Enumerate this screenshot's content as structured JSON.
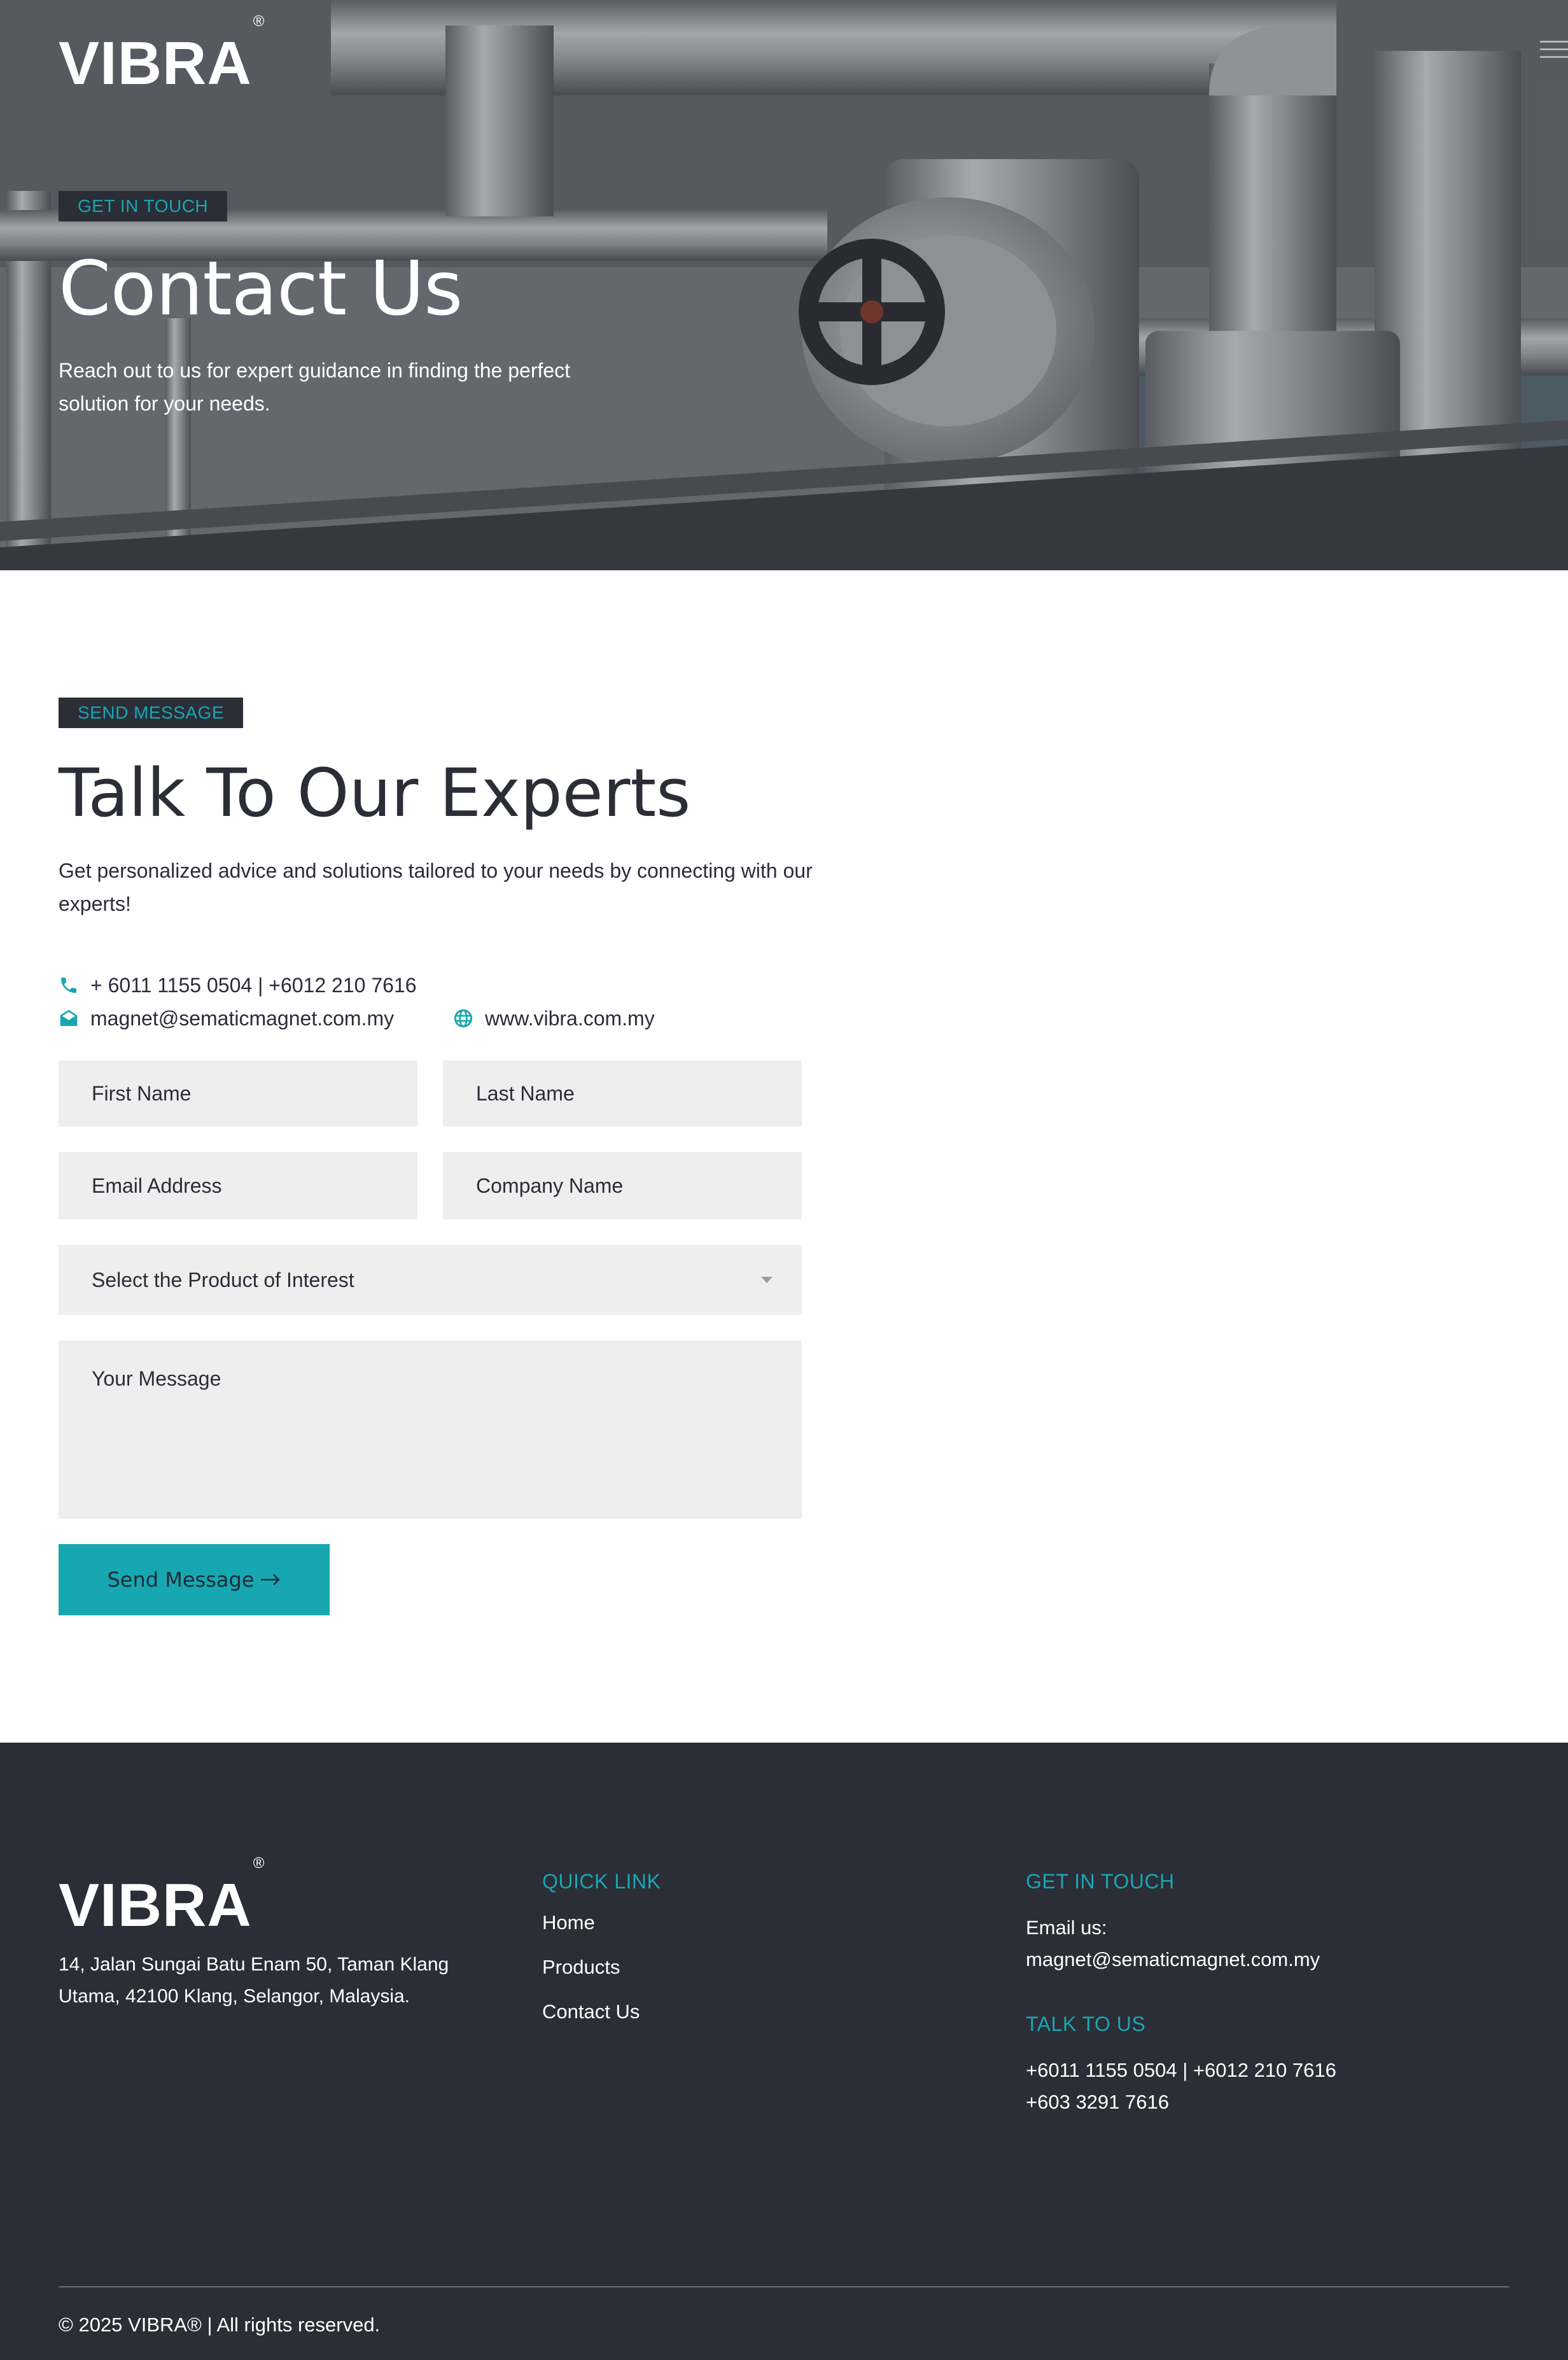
{
  "brand": {
    "name": "VIBRA",
    "reg_mark": "®",
    "accent": "#17a7b0",
    "dark": "#2b2d37"
  },
  "hero": {
    "tag": "GET IN TOUCH",
    "title": "Contact Us",
    "subtitle": "Reach out to us for expert guidance in finding the perfect solution for your needs."
  },
  "contact": {
    "tag": "SEND MESSAGE",
    "title": "Talk To Our Experts",
    "lead": "Get personalized advice and solutions tailored to your needs by connecting with our experts!",
    "phone": "+ 6011 1155 0504 | +6012 210 7616",
    "email": "magnet@sematicmagnet.com.my",
    "website": "www.vibra.com.my",
    "icons": {
      "phone": "phone-icon",
      "email": "envelope-open-icon",
      "website": "globe-icon"
    }
  },
  "form": {
    "first_name_placeholder": "First Name",
    "last_name_placeholder": "Last Name",
    "email_placeholder": "Email Address",
    "company_placeholder": "Company Name",
    "product_select": "Select the Product of Interest",
    "message_placeholder": "Your Message",
    "submit_label": "Send Message"
  },
  "footer": {
    "address": "14, Jalan Sungai Batu Enam 50, Taman Klang Utama, 42100 Klang, Selangor, Malaysia.",
    "quick_link_heading": "QUICK LINK",
    "quick_links": [
      "Home",
      "Products",
      "Contact Us"
    ],
    "get_in_touch_heading": "GET IN TOUCH",
    "email_label": "Email us:",
    "email": "magnet@sematicmagnet.com.my",
    "talk_heading": "TALK TO US",
    "phone_line_1": "+6011 1155 0504 | +6012 210 7616",
    "phone_line_2": "+603 3291 7616",
    "copyright": "© 2025 VIBRA® | All rights reserved."
  }
}
